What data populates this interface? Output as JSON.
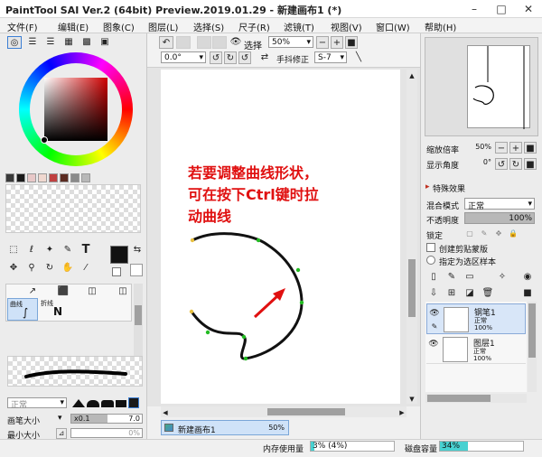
{
  "window": {
    "title": "PaintTool SAI Ver.2 (64bit) Preview.2019.01.29 - 新建画布1 (*)",
    "minimize_icon": "minimize-icon",
    "maximize_icon": "maximize-icon",
    "close_icon": "close-icon"
  },
  "menu": [
    "文件(F)",
    "编辑(E)",
    "图象(C)",
    "图层(L)",
    "选择(S)",
    "尺子(R)",
    "滤镜(T)",
    "视图(V)",
    "窗口(W)",
    "帮助(H)"
  ],
  "toolbar": {
    "selection_label": "选择",
    "zoom_value": "50%",
    "rotation_value": "0.0°",
    "stabilizer_label": "手抖修正",
    "stabilizer_value": "S-7"
  },
  "annotation": {
    "line1": "若要调整曲线形状，",
    "line2": "可在按下Ctrl键时拉",
    "line3": "动曲线"
  },
  "tools": {
    "curve_label": "曲线",
    "polyline_label": "折线",
    "text_tool_glyph": "T"
  },
  "brush": {
    "mode": "正常",
    "size_label": "画笔大小",
    "size_multiplier": "x0.1",
    "size_value": "7.0",
    "min_size_label": "最小大小",
    "min_size_value": "0%"
  },
  "navigator": {
    "zoom_label": "缩放倍率",
    "zoom_value": "50%",
    "angle_label": "显示角度",
    "angle_value": "0°"
  },
  "effects": {
    "title": "特殊效果"
  },
  "layer_props": {
    "blend_label": "混合模式",
    "blend_value": "正常",
    "opacity_label": "不透明度",
    "opacity_value": "100%",
    "lock_label": "锁定",
    "clip_label": "创建剪贴蒙版",
    "select_source_label": "指定为选区样本"
  },
  "layers": [
    {
      "name": "钢笔1",
      "mode": "正常",
      "opacity": "100%",
      "selected": true
    },
    {
      "name": "图层1",
      "mode": "正常",
      "opacity": "100%",
      "selected": false
    }
  ],
  "doc_tab": {
    "name": "新建画布1",
    "zoom": "50%"
  },
  "status": {
    "memory_label": "内存使用量",
    "memory_value": "3% (4%)",
    "memory_fraction": 0.04,
    "disk_label": "磁盘容量",
    "disk_value": "34%",
    "disk_fraction": 0.34
  },
  "colors": {
    "annotation_red": "#e01010",
    "accent_blue": "#3c7fd4",
    "point_green": "#22bb22",
    "point_yellow": "#e8c040"
  },
  "swatches": [
    "#3a3a3a",
    "#1a1a1a",
    "#e8c8c8",
    "#f0d8d0",
    "#c04040",
    "#5a2a20",
    "#8a8a8a",
    "#b8b8b8"
  ],
  "foreground_color": "#111111"
}
